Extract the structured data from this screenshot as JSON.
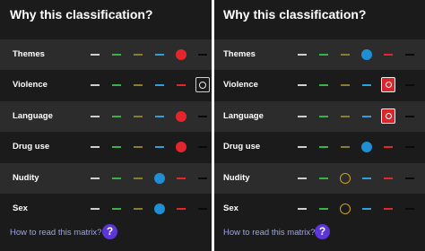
{
  "colors": {
    "white": "#cfcfcf",
    "green": "#37b34a",
    "olive": "#8a7d2e",
    "blue": "#2f9fe0",
    "red": "#e2262a",
    "black": "#0a0a0a",
    "dot_red": "#e3262b",
    "dot_blue": "#1f8fd4",
    "ring_yellow": "#c9a51a"
  },
  "panels": [
    {
      "title": "Why this classification?",
      "footer": {
        "link": "How to read this matrix?",
        "help": "?"
      },
      "rows": [
        {
          "label": "Themes",
          "level": 4,
          "marker": "dot-red"
        },
        {
          "label": "Violence",
          "level": 5,
          "marker": "badge-outline"
        },
        {
          "label": "Language",
          "level": 4,
          "marker": "dot-red"
        },
        {
          "label": "Drug use",
          "level": 4,
          "marker": "dot-red"
        },
        {
          "label": "Nudity",
          "level": 3,
          "marker": "dot-blue"
        },
        {
          "label": "Sex",
          "level": 3,
          "marker": "dot-blue"
        }
      ]
    },
    {
      "title": "Why this classification?",
      "footer": {
        "link": "How to read this matrix?",
        "help": "?"
      },
      "rows": [
        {
          "label": "Themes",
          "level": 3,
          "marker": "dot-blue"
        },
        {
          "label": "Violence",
          "level": 4,
          "marker": "badge-red"
        },
        {
          "label": "Language",
          "level": 4,
          "marker": "badge-red"
        },
        {
          "label": "Drug use",
          "level": 3,
          "marker": "dot-blue"
        },
        {
          "label": "Nudity",
          "level": 2,
          "marker": "ring-yellow"
        },
        {
          "label": "Sex",
          "level": 2,
          "marker": "ring-yellow"
        }
      ]
    }
  ]
}
